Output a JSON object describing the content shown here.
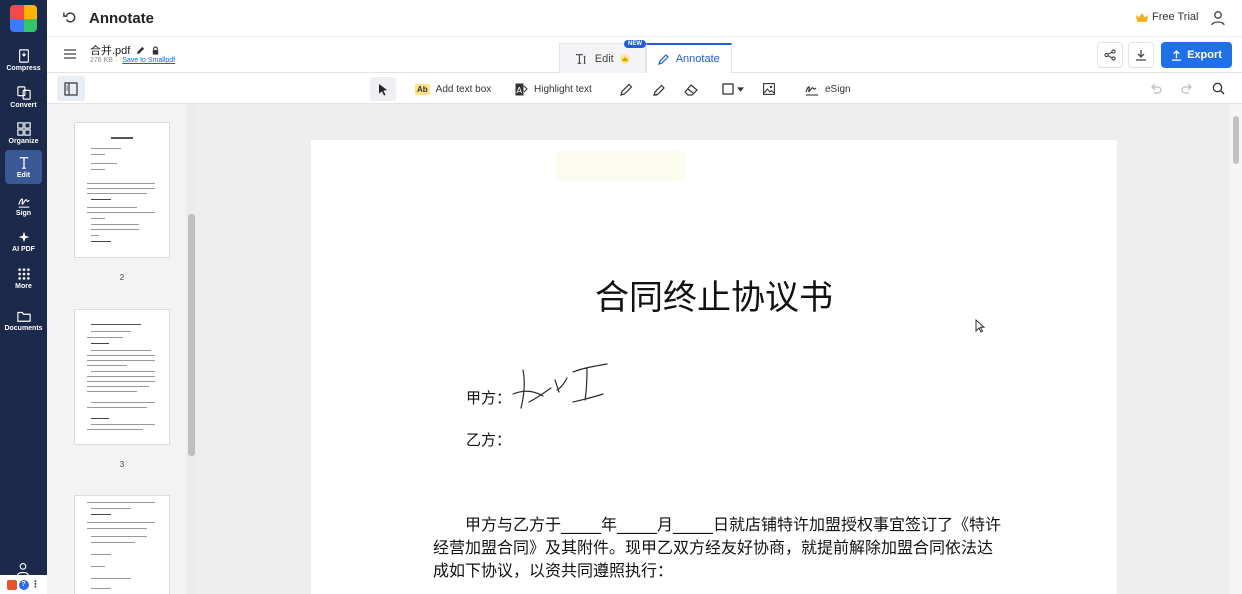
{
  "app": {
    "title": "Annotate",
    "free_trial_label": "Free Trial"
  },
  "rail": {
    "items": [
      {
        "label": "Compress",
        "icon": "compress-icon"
      },
      {
        "label": "Convert",
        "icon": "convert-icon"
      },
      {
        "label": "Organize",
        "icon": "organize-icon"
      },
      {
        "label": "Edit",
        "icon": "edit-text-icon",
        "active": true
      },
      {
        "label": "Sign",
        "icon": "sign-icon"
      },
      {
        "label": "AI PDF",
        "icon": "sparkle-icon"
      },
      {
        "label": "More",
        "icon": "grid-icon"
      },
      {
        "label": "Documents",
        "icon": "folder-icon"
      }
    ]
  },
  "file": {
    "name": "合并.pdf",
    "size": "276 KB",
    "save_link": "Save to Smallpdf"
  },
  "modes": {
    "edit_label": "Edit",
    "annotate_label": "Annotate",
    "new_badge": "NEW"
  },
  "actions": {
    "export_label": "Export"
  },
  "toolbar": {
    "add_text_box": "Add text box",
    "highlight_text": "Highlight text",
    "esign": "eSign",
    "ab_glyph": "Ab"
  },
  "thumbnails": {
    "pages": [
      "2",
      "3"
    ]
  },
  "document": {
    "title": "合同终止协议书",
    "party_a": "甲方：",
    "party_b": "乙方：",
    "paragraph": "甲方与乙方于_____年_____月_____日就店铺特许加盟授权事宜签订了《特许经营加盟合同》及其附件。现甲乙双方经友好协商，就提前解除加盟合同依法达成如下协议，以资共同遵照执行："
  },
  "colors": {
    "rail_bg": "#1b2a4a",
    "accent": "#1f6fe8",
    "rail_active": "#3a5796"
  }
}
